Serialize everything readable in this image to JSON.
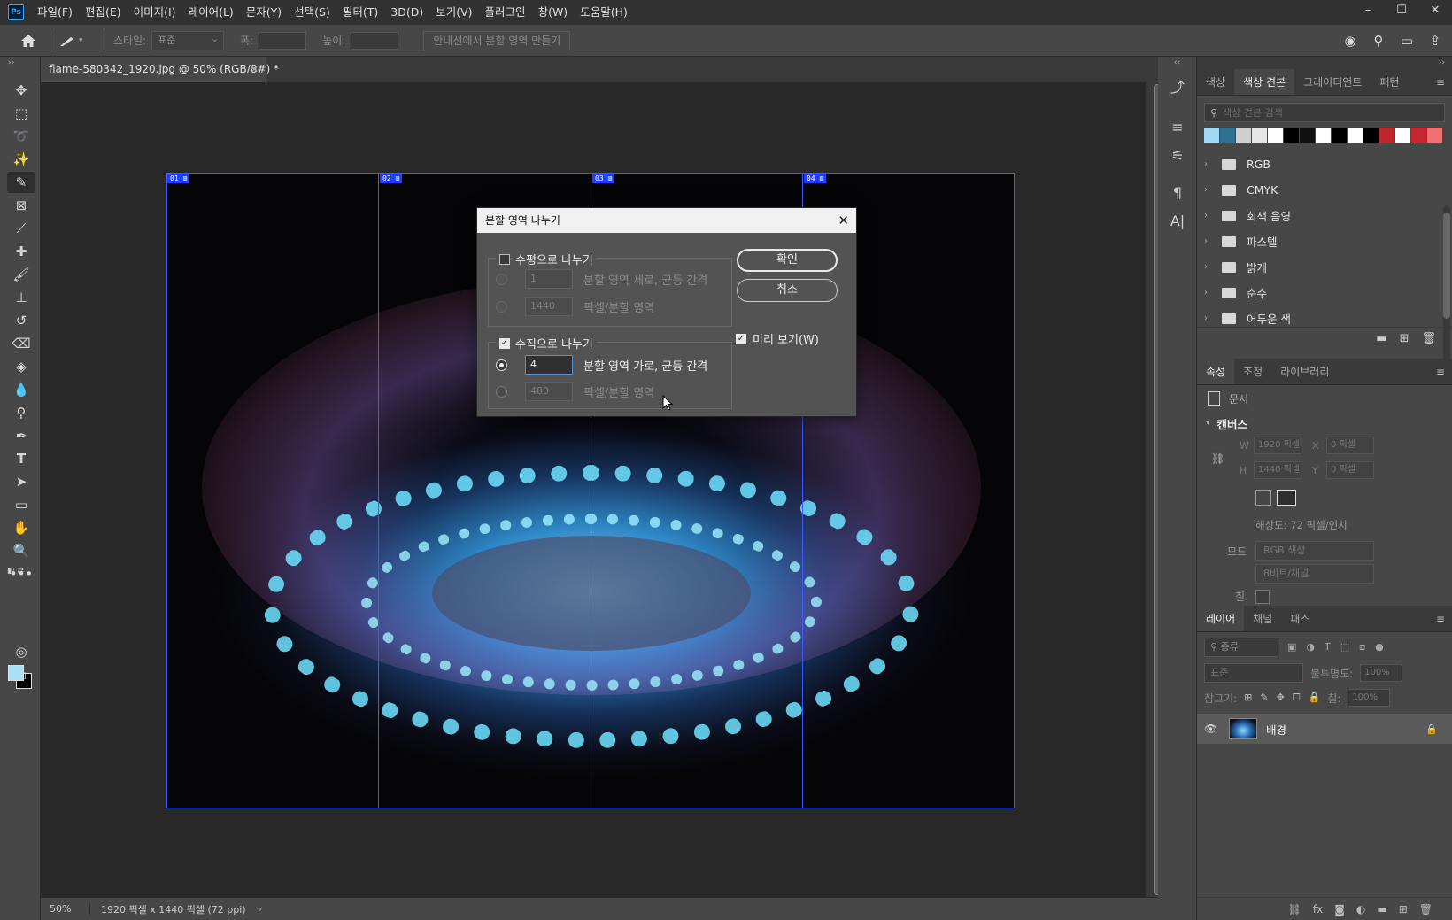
{
  "app": {
    "logo": "Ps"
  },
  "menu": [
    "파일(F)",
    "편집(E)",
    "이미지(I)",
    "레이어(L)",
    "문자(Y)",
    "선택(S)",
    "필터(T)",
    "3D(D)",
    "보기(V)",
    "플러그인",
    "창(W)",
    "도움말(H)"
  ],
  "window_controls": {
    "minimize": "–",
    "restore": "☐",
    "close": "✕"
  },
  "options": {
    "style_label": "스타일:",
    "style_value": "표준",
    "width_label": "폭:",
    "height_label": "높이:",
    "guides_button": "안내선에서 분할 영역 만들기"
  },
  "document": {
    "tab_title": "flame-580342_1920.jpg @ 50% (RGB/8#) *",
    "tab_close": "✕",
    "zoom": "50%",
    "info": "1920 픽셀 x 1440 픽셀 (72 ppi)",
    "info_arrow": "›",
    "slices": [
      "01",
      "02",
      "03",
      "04"
    ]
  },
  "dialog": {
    "title": "분할 영역 나누기",
    "close": "✕",
    "horizontal": {
      "label": "수평으로 나누기",
      "checked": false,
      "count_value": "1",
      "count_label": "분할 영역 세로, 균등 간격",
      "pixel_value": "1440",
      "pixel_label": "픽셀/분할 영역"
    },
    "vertical": {
      "label": "수직으로 나누기",
      "checked": true,
      "count_value": "4",
      "count_label": "분할 영역 가로, 균등 간격",
      "pixel_value": "480",
      "pixel_label": "픽셀/분할 영역"
    },
    "ok": "확인",
    "cancel": "취소",
    "preview": "미리 보기(W)",
    "check_glyph": "✓"
  },
  "swatches_panel": {
    "tabs": [
      "색상",
      "색상 견본",
      "그레이디언트",
      "패턴"
    ],
    "active_tab": 1,
    "menu": "≡",
    "search_placeholder": "색상 견본 검색",
    "colors": [
      "#9fd9f5",
      "#2f6f8f",
      "#cfcfcf",
      "#e6e6e6",
      "#ffffff",
      "#000000",
      "#111111",
      "#ffffff",
      "#000000",
      "#ffffff",
      "#000000",
      "#c0272d",
      "#ffffff",
      "#c6262e",
      "#f07070"
    ],
    "folders": [
      "RGB",
      "CMYK",
      "회색 음영",
      "파스텔",
      "밝게",
      "순수",
      "어두운 색"
    ]
  },
  "properties_panel": {
    "tabs": [
      "속성",
      "조정",
      "라이브러리"
    ],
    "doc_label": "문서",
    "section": "캔버스",
    "w_label": "W",
    "w_value": "1920 픽셀",
    "h_label": "H",
    "h_value": "1440 픽셀",
    "x_label": "X",
    "x_value": "0 픽셀",
    "y_label": "Y",
    "y_value": "0 픽셀",
    "resolution": "해상도: 72 픽셀/인치",
    "mode_label": "모드",
    "mode_value": "RGB 색상",
    "depth_value": "8비트/채널",
    "fill_label": "칠"
  },
  "layers_panel": {
    "tabs": [
      "레이어",
      "채널",
      "패스"
    ],
    "filter_value": "종류",
    "blend_value": "표준",
    "opacity_label": "불투명도:",
    "opacity_value": "100%",
    "lock_label": "잠그기:",
    "fill_label": "칠:",
    "fill_value": "100%",
    "layer_name": "배경"
  },
  "tools": [
    "move",
    "marquee",
    "lasso",
    "magic-wand",
    "slice",
    "frame",
    "eyedropper",
    "healing",
    "brush",
    "stamp",
    "history-brush",
    "eraser",
    "paint-bucket",
    "blur",
    "dodge",
    "pen",
    "type",
    "path-select",
    "rectangle",
    "hand",
    "zoom",
    "more"
  ],
  "colors": {
    "foreground": "#a9dff7",
    "background": "#000000",
    "slice_line": "#3d5cff"
  }
}
